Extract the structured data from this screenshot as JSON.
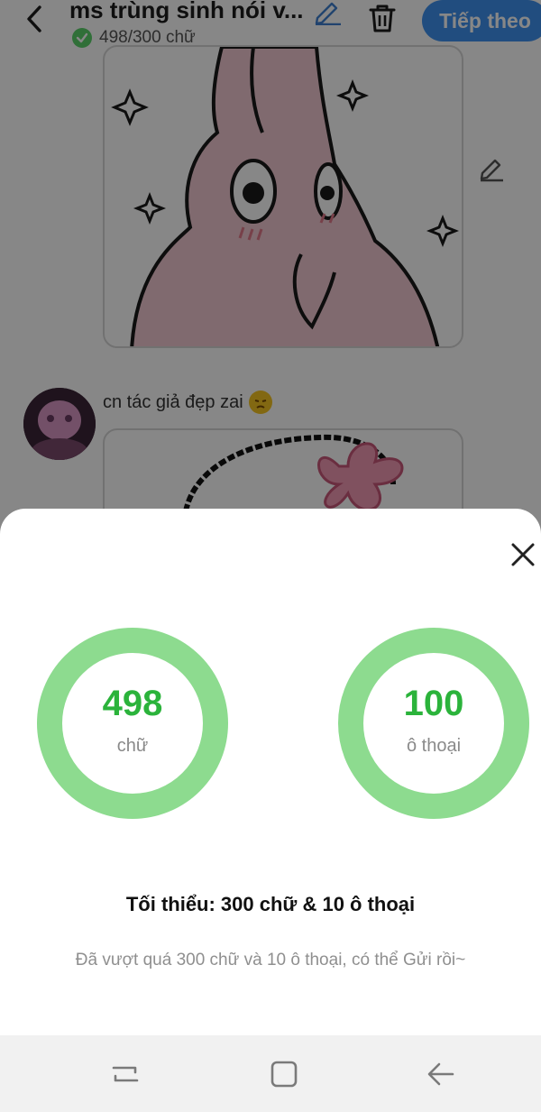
{
  "header": {
    "title": "ms trùng sinh nói v...",
    "word_count": "498/300 chữ",
    "next_label": "Tiếp theo"
  },
  "feed": {
    "author_caption": "cn tác giả đẹp zai"
  },
  "sheet": {
    "stats": [
      {
        "value": "498",
        "label": "chữ"
      },
      {
        "value": "100",
        "label": "ô thoại"
      }
    ],
    "minimum": "Tối thiểu: 300 chữ & 10 ô thoại",
    "hint": "Đã vượt quá 300 chữ và 10 ô thoại, có thể Gửi rồi~"
  },
  "colors": {
    "ring": "#8ddb8f",
    "value": "#2bb33b",
    "accent": "#3f92f0"
  },
  "icons": {
    "back": "chevron-left-icon",
    "edit": "pencil-icon",
    "delete": "trash-icon",
    "close": "close-icon",
    "check": "check-icon"
  }
}
